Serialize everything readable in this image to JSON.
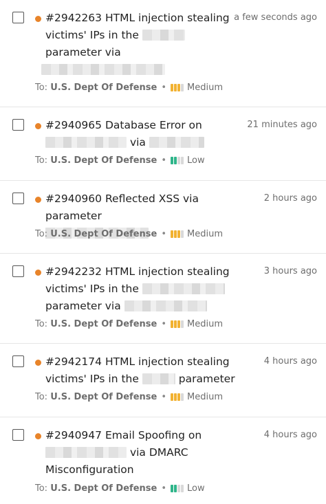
{
  "reports": [
    {
      "id": "#2942263",
      "title_parts": [
        "HTML injection stealing victims' IPs in the",
        "parameter via"
      ],
      "time": "a few seconds ago",
      "to_label": "To:",
      "program": "U.S. Dept Of Defense",
      "separator": "•",
      "severity": "Medium",
      "severity_level": 3
    },
    {
      "id": "#2940965",
      "title_parts": [
        "Database Error on",
        "via"
      ],
      "time": "21 minutes ago",
      "to_label": "To:",
      "program": "U.S. Dept Of Defense",
      "separator": "•",
      "severity": "Low",
      "severity_level": 2
    },
    {
      "id": "#2940960",
      "title_parts": [
        "Reflected XSS via parameter"
      ],
      "time": "2 hours ago",
      "to_label": "To:",
      "program": "U.S. Dept Of Defense",
      "separator": "•",
      "severity": "Medium",
      "severity_level": 3
    },
    {
      "id": "#2942232",
      "title_parts": [
        "HTML injection stealing victims' IPs in the",
        "parameter via"
      ],
      "time": "3 hours ago",
      "to_label": "To:",
      "program": "U.S. Dept Of Defense",
      "separator": "•",
      "severity": "Medium",
      "severity_level": 3
    },
    {
      "id": "#2942174",
      "title_parts": [
        "HTML injection stealing victims' IPs in the",
        "parameter"
      ],
      "time": "4 hours ago",
      "to_label": "To:",
      "program": "U.S. Dept Of Defense",
      "separator": "•",
      "severity": "Medium",
      "severity_level": 3
    },
    {
      "id": "#2940947",
      "title_parts": [
        "Email Spoofing on",
        "via DMARC Misconfiguration"
      ],
      "time": "4 hours ago",
      "to_label": "To:",
      "program": "U.S. Dept Of Defense",
      "separator": "•",
      "severity": "Low",
      "severity_level": 2
    }
  ],
  "colors": {
    "state_dot": "#e8842a",
    "severity_medium": "#f2b232",
    "severity_low": "#2fb58a",
    "severity_empty": "#d9d9d9",
    "divider": "#e6e6e6"
  }
}
